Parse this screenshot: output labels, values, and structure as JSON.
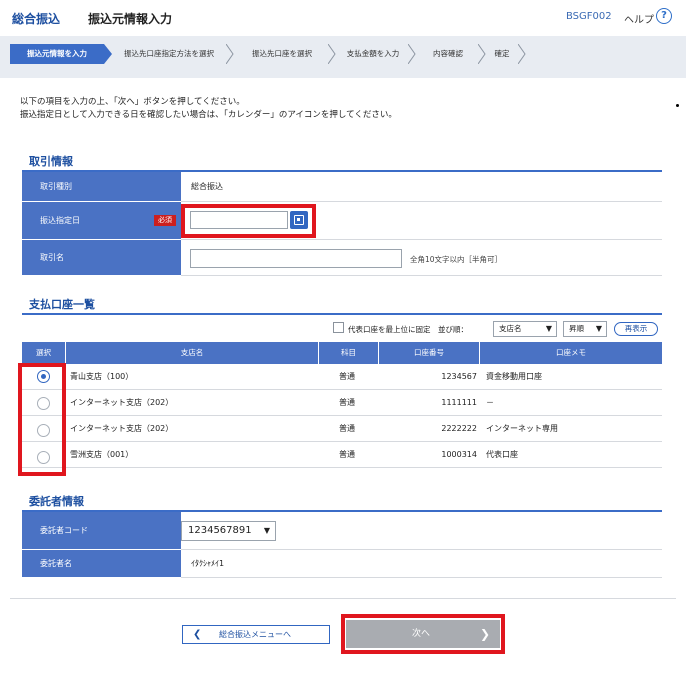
{
  "header": {
    "service_name": "総合振込",
    "page_title": "振込元情報入力",
    "screen_code": "BSGF002",
    "help_label": "ヘルプ",
    "help_icon": "?"
  },
  "steps": [
    "振込元情報を入力",
    "振込先口座指定方法を選択",
    "振込先口座を選択",
    "支払金額を入力",
    "内容確認",
    "確定"
  ],
  "intro": {
    "line1": "以下の項目を入力の上、「次へ」ボタンを押してください。",
    "line2": "振込指定日として入力できる日を確認したい場合は、「カレンダー」のアイコンを押してください。"
  },
  "transaction": {
    "section_title": "取引情報",
    "type_label": "取引種別",
    "type_value": "総合振込",
    "date_label": "振込指定日",
    "required_badge": "必須",
    "date_value": "",
    "name_label": "取引名",
    "name_value": "",
    "name_hint": "全角10文字以内［半角可］"
  },
  "accounts": {
    "section_title": "支払口座一覧",
    "pin_label": "代表口座を最上位に固定",
    "sort_label": "並び順：",
    "sort_value": "支店名",
    "order_value": "昇順",
    "redisplay_label": "再表示",
    "columns": [
      "選択",
      "支店名",
      "科目",
      "口座番号",
      "口座メモ"
    ],
    "rows": [
      {
        "selected": true,
        "branch": "青山支店（100）",
        "type": "普通",
        "number": "1234567",
        "memo": "資金移動用口座"
      },
      {
        "selected": false,
        "branch": "インターネット支店（202）",
        "type": "普通",
        "number": "1111111",
        "memo": "－"
      },
      {
        "selected": false,
        "branch": "インターネット支店（202）",
        "type": "普通",
        "number": "2222222",
        "memo": "インターネット専用"
      },
      {
        "selected": false,
        "branch": "雪洲支店（001）",
        "type": "普通",
        "number": "1000314",
        "memo": "代表口座"
      }
    ]
  },
  "consignor": {
    "section_title": "委託者情報",
    "code_label": "委託者コード",
    "code_value": "1234567891",
    "name_label": "委託者名",
    "name_value": "ｲﾀｸｼｬﾒｲ1"
  },
  "buttons": {
    "back_label": "総合振込メニューへ",
    "next_label": "次へ"
  },
  "colors": {
    "accent": "#3b6cc7",
    "highlight": "#e0161e",
    "required": "#cc1f1f",
    "disabled": "#a9acb1"
  }
}
